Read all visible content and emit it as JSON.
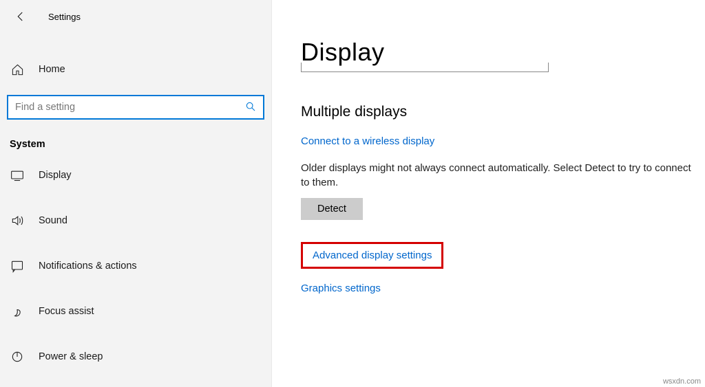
{
  "app": {
    "title": "Settings"
  },
  "sidebar": {
    "home_label": "Home",
    "section_title": "System",
    "items": [
      {
        "label": "Display"
      },
      {
        "label": "Sound"
      },
      {
        "label": "Notifications & actions"
      },
      {
        "label": "Focus assist"
      },
      {
        "label": "Power & sleep"
      }
    ]
  },
  "search": {
    "placeholder": "Find a setting"
  },
  "main": {
    "page_title": "Display",
    "section_heading": "Multiple displays",
    "wireless_link": "Connect to a wireless display",
    "older_text": "Older displays might not always connect automatically. Select Detect to try to connect to them.",
    "detect_label": "Detect",
    "advanced_link": "Advanced display settings",
    "graphics_link": "Graphics settings"
  },
  "watermark": "wsxdn.com"
}
